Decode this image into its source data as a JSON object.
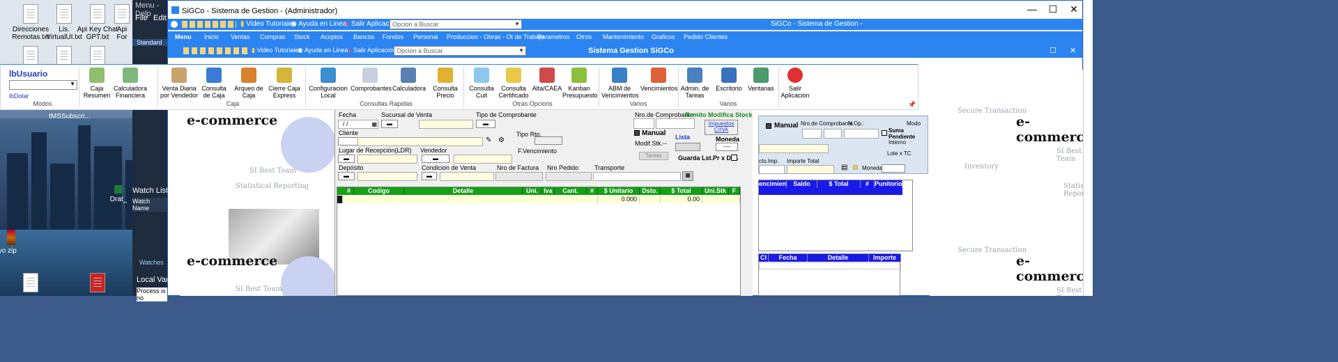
{
  "desktop": {
    "icons": [
      {
        "label": "Direcciones Remotas.txt"
      },
      {
        "label": "Lis. VirtualUI.txt"
      },
      {
        "label": "Api Key Chat GPT.txt"
      },
      {
        "label": "Api For"
      },
      {
        "label": "tMSSubscri..."
      },
      {
        "label": "Drat_"
      },
      {
        "label": "ayo zip"
      }
    ]
  },
  "background_app": {
    "title": "Menu - Delp",
    "menu": [
      "File",
      "Edit"
    ],
    "toolbar_label": "Standard",
    "watch_list": "Watch List",
    "watch_name": "Watch Name",
    "watches": "Watches",
    "local_vars": "Local Vari",
    "process": "Process is no"
  },
  "window": {
    "title": "SiGCo - Sistema de Gestion - (Administrador)",
    "controls": {
      "minimize": "—",
      "maximize": "☐",
      "close": "✕"
    }
  },
  "top_toolbar": {
    "video": "Video Tutoriales",
    "help": "Ayuda en Linea",
    "exit": "Salir Aplicacion",
    "search_placeholder": "Opcion a Buscar",
    "app_title": "SiGCo - Sistema de Gestion -"
  },
  "menu_bar": {
    "items": [
      "Menu",
      "Inicio",
      "Ventas",
      "Compras",
      "Stock",
      "Acopios",
      "Bancos",
      "Fondos",
      "Personal",
      "Produccion - Obras - Ot de Trabajo",
      "Parametros",
      "Otros",
      "Mantenimiento",
      "Graficos",
      "Pedido Clientes"
    ]
  },
  "inner_toolbar": {
    "video": "Video Tutoriales",
    "help": "Ayuda en Linea",
    "exit": "Salir Aplicacion",
    "search_placeholder": "Opcion a Buscar",
    "title": "Sistema Gestion SiGCo"
  },
  "ribbon": {
    "user": "lbUsuario",
    "dolar": "lbDolar",
    "groups": [
      "Modos",
      "Caja",
      "Consultas Rapidas",
      "Otras Opcions",
      "Varios",
      "Varios"
    ],
    "buttons": [
      {
        "label": "Caja Resumen",
        "color": "#8fbf6a"
      },
      {
        "label": "Calculadora Financiera",
        "color": "#7cb87c"
      },
      {
        "label": "Venta Diaria por Vendedor",
        "color": "#c8a46a"
      },
      {
        "label": "Consulta de Caja",
        "color": "#3a7bd5"
      },
      {
        "label": "Arqueo de Caja",
        "color": "#d9822b"
      },
      {
        "label": "Cierre Caja Express",
        "color": "#d4b43a"
      },
      {
        "label": "Configuracion Local",
        "color": "#3a8fd0"
      },
      {
        "label": "Comprobantes",
        "color": "#c8d0e0"
      },
      {
        "label": "Calculadora",
        "color": "#5a7fb0"
      },
      {
        "label": "Consulta Precio",
        "color": "#e0b030"
      },
      {
        "label": "Consulta Cuit",
        "color": "#8ec8f0"
      },
      {
        "label": "Consulta Certificado",
        "color": "#e8c84a"
      },
      {
        "label": "Alta/CAEA",
        "color": "#d04a4a"
      },
      {
        "label": "Kanban Presupuesto",
        "color": "#8cbf3a"
      },
      {
        "label": "ABM de Vencimientos",
        "color": "#3a80c8"
      },
      {
        "label": "Vencimientos",
        "color": "#e0603a"
      },
      {
        "label": "Admin. de Tareas",
        "color": "#4a80c0"
      },
      {
        "label": "Escritorio",
        "color": "#3a70c0"
      },
      {
        "label": "Ventanas",
        "color": "#4a9a6a"
      },
      {
        "label": "Salir Aplicacion",
        "color": "#e03030"
      }
    ]
  },
  "form": {
    "fecha_label": "Fecha",
    "fecha_value": "/ /",
    "sucursal_label": "Sucursal de Venta",
    "tipo_comp_label": "Tipo de Comprobante",
    "nro_comp_label": "Nro.de Comprobante",
    "remito_label": "Remito Modifica Stock",
    "impuestos_label": "Impuestos C/IVA",
    "cliente_label": "Cliente",
    "tipo_rto_label": "Tipo Rto.",
    "manual_label": "Manual",
    "lista_label": "Lista",
    "moneda_label": "Moneda",
    "modif_stk_label": "Modif.Stk.",
    "modif_stk_value": "--",
    "moneda_value": "----",
    "lugar_label": "Lugar de Recepción(LDR)",
    "vendedor_label": "Vendedor",
    "fvenc_label": "F.Vencimiento",
    "tareas_label": "Tareas",
    "guarda_label": "Guarda Lst.Pr x Def.",
    "deposito_label": "Depósito",
    "condicion_label": "Condicion de Venta",
    "nro_factura_label": "Nro de Factura",
    "nro_pedido_label": "Nro Pedido",
    "transporte_label": "Transporte"
  },
  "grid": {
    "columns": [
      "#",
      "Codigo",
      "Detalle",
      "Uni.",
      "Iva",
      "Cant.",
      "#",
      "$ Unitario",
      "Dsto.",
      "$ Total",
      "Uni.Stk",
      "F"
    ],
    "row": {
      "unitario": "0.000",
      "total": "0.00"
    }
  },
  "right_panel": {
    "manual_label": "Manual",
    "nro_comp_label": "Nro.de Comprobante",
    "nop_label": "N.Op.:",
    "modo_label": "Modo",
    "suma_label": "Suma Pendiente",
    "interno_label": "Interno",
    "lote_label": "Lote x TC",
    "cto_label": "cto.Imp.",
    "importe_total_label": "Importe Total",
    "moneda_label": "Moneda"
  },
  "right_grid1": {
    "columns": [
      "encimiento",
      "Saldo",
      "$ Total",
      "#",
      "Punitorio"
    ]
  },
  "right_grid2": {
    "columns": [
      "Cl",
      "Fecha",
      "Detalle",
      "Importe"
    ]
  },
  "banners": {
    "ecommerce": "e-commerce",
    "team": "SI Best Team",
    "stat": "Statistical Reporting",
    "secure": "Secure Transaction",
    "inventory": "Inventory"
  }
}
